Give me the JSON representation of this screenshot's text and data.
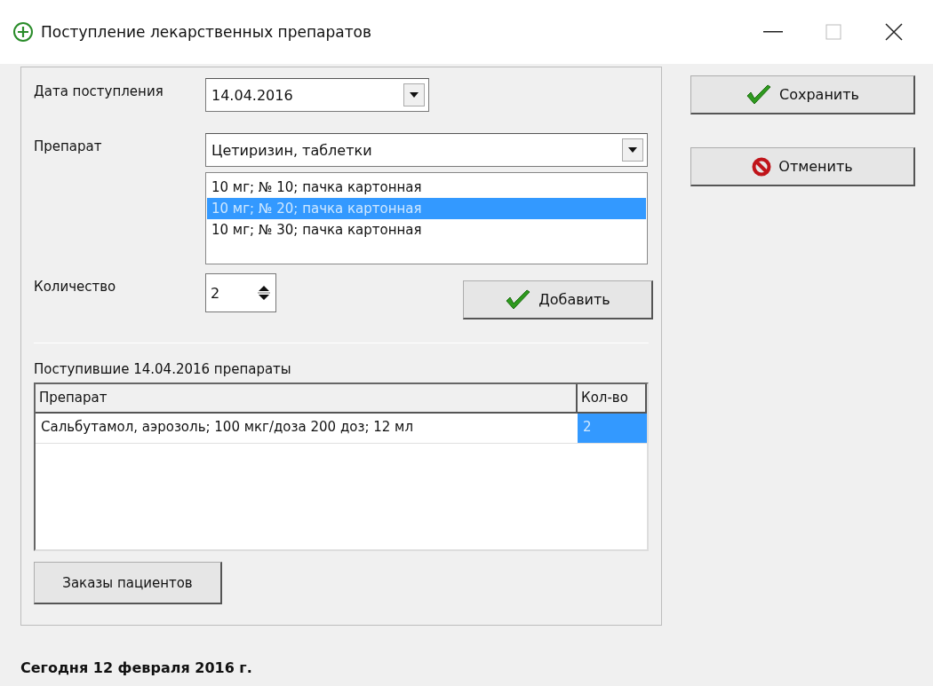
{
  "window": {
    "title": "Поступление лекарственных препаратов"
  },
  "form": {
    "date_label": "Дата поступления",
    "date_value": "14.04.2016",
    "drug_label": "Препарат",
    "drug_value": "Цетиризин, таблетки",
    "forms": [
      {
        "label": "10 мг; № 10; пачка картонная",
        "selected": false
      },
      {
        "label": "10 мг; № 20; пачка картонная",
        "selected": true
      },
      {
        "label": "10 мг; № 30; пачка картонная",
        "selected": false
      }
    ],
    "quantity_label": "Количество",
    "quantity_value": "2",
    "add_button": "Добавить"
  },
  "received": {
    "caption": "Поступившие 14.04.2016 препараты",
    "columns": [
      "Препарат",
      "Кол-во"
    ],
    "rows": [
      {
        "cells": [
          {
            "text": "Сальбутамол, аэрозоль; 100 мкг/доза 200 доз; 12 мл",
            "selected": false
          },
          {
            "text": "2",
            "selected": true
          }
        ]
      }
    ]
  },
  "orders_button": "Заказы пациентов",
  "actions": [
    {
      "kind": "save",
      "label": "Сохранить"
    },
    {
      "kind": "cancel",
      "label": "Отменить"
    }
  ],
  "status": "Сегодня 12 февраля 2016 г."
}
